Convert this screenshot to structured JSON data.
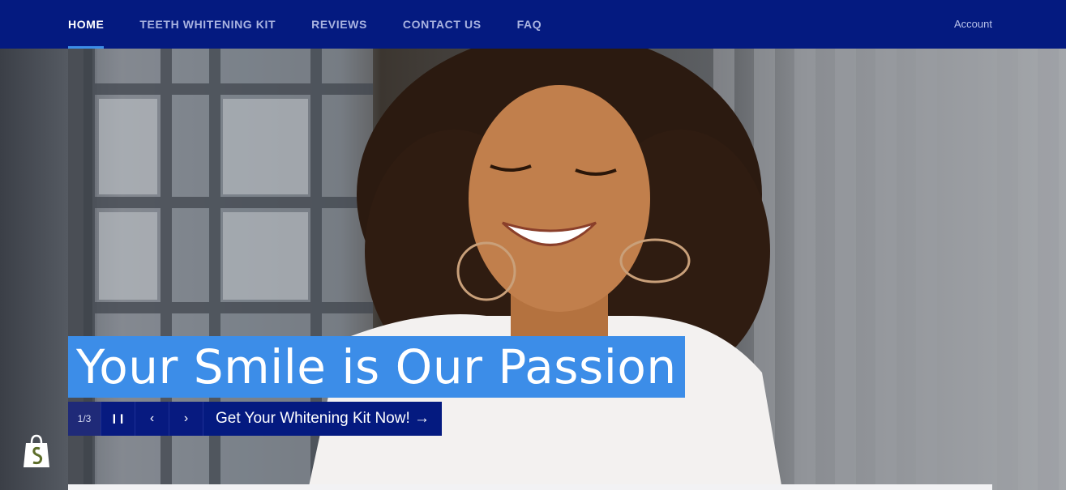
{
  "nav": {
    "items": [
      {
        "label": "HOME",
        "active": true
      },
      {
        "label": "TEETH WHITENING KIT",
        "active": false
      },
      {
        "label": "REVIEWS",
        "active": false
      },
      {
        "label": "CONTACT US",
        "active": false
      },
      {
        "label": "FAQ",
        "active": false
      }
    ],
    "account": "Account"
  },
  "hero": {
    "title": "Your Smile is Our Passion",
    "slide_counter": "1/3",
    "cta_label": "Get Your Whitening Kit Now! →",
    "pause_icon": "pause-icon",
    "prev_icon": "chevron-left-icon",
    "next_icon": "chevron-right-icon"
  },
  "colors": {
    "header_bg": "#041a80",
    "accent": "#3c8de8",
    "nav_text": "#a9b3e0"
  },
  "badge_icon": "shopify-bag-icon"
}
